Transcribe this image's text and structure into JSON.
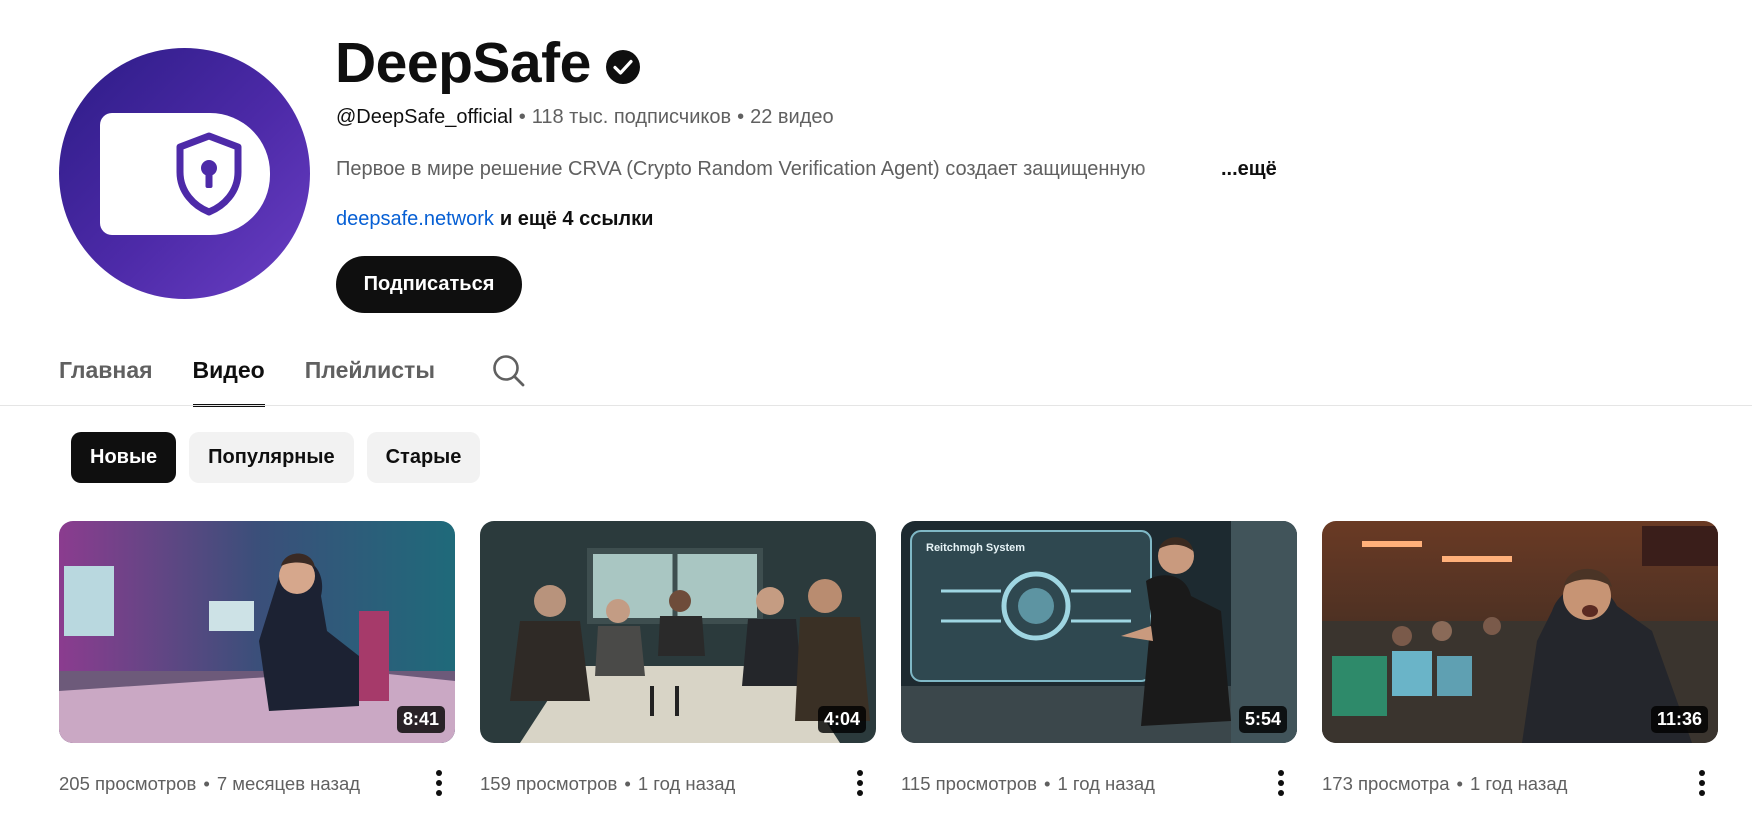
{
  "channel": {
    "name": "DeepSafe",
    "handle": "@DeepSafe_official",
    "subscribers": "118 тыс. подписчиков",
    "video_count": "22 видео",
    "separator": "•",
    "description": "Первое в мире решение CRVA (Crypto Random Verification Agent) создает защищенную",
    "description_more": "...ещё",
    "link": "deepsafe.network",
    "more_links": "и ещё 4 ссылки",
    "subscribe_label": "Подписаться"
  },
  "tabs": [
    {
      "label": "Главная",
      "active": false
    },
    {
      "label": "Видео",
      "active": true
    },
    {
      "label": "Плейлисты",
      "active": false
    }
  ],
  "chips": [
    {
      "label": "Новые",
      "active": true
    },
    {
      "label": "Популярные",
      "active": false
    },
    {
      "label": "Старые",
      "active": false
    }
  ],
  "videos": [
    {
      "duration": "8:41",
      "views": "205 просмотров",
      "age": "7 месяцев назад"
    },
    {
      "duration": "4:04",
      "views": "159 просмотров",
      "age": "1 год назад"
    },
    {
      "duration": "5:54",
      "views": "115 просмотров",
      "age": "1 год назад",
      "thumb_text": "Reitchmgh System"
    },
    {
      "duration": "11:36",
      "views": "173 просмотра",
      "age": "1 год назад"
    }
  ],
  "meta_dot": "•",
  "colors": {
    "accent": "#0f0f0f",
    "link": "#065fd4",
    "avatar": "#4d2aa8"
  }
}
